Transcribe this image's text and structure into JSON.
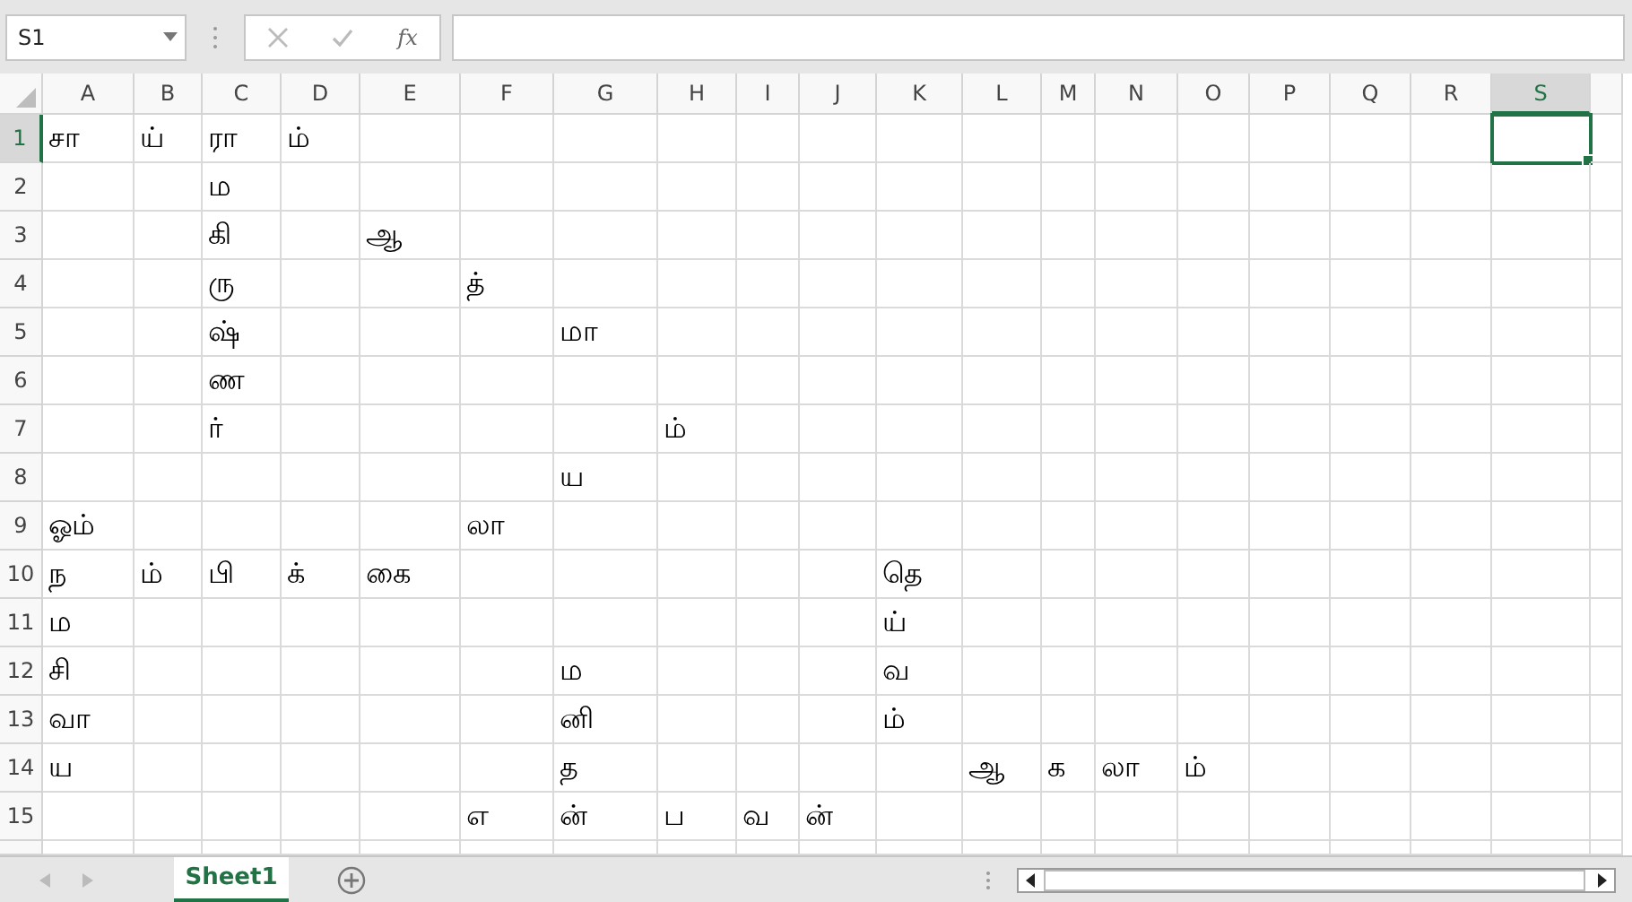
{
  "name_box": {
    "value": "S1"
  },
  "formula_bar": {
    "function_label": "fx",
    "value_disabled": true
  },
  "columns": [
    {
      "label": "A",
      "selected": false
    },
    {
      "label": "B",
      "selected": false
    },
    {
      "label": "C",
      "selected": false
    },
    {
      "label": "D",
      "selected": false
    },
    {
      "label": "E",
      "selected": false
    },
    {
      "label": "F",
      "selected": false
    },
    {
      "label": "G",
      "selected": false
    },
    {
      "label": "H",
      "selected": false
    },
    {
      "label": "I",
      "selected": false
    },
    {
      "label": "J",
      "selected": false
    },
    {
      "label": "K",
      "selected": false
    },
    {
      "label": "L",
      "selected": false
    },
    {
      "label": "M",
      "selected": false
    },
    {
      "label": "N",
      "selected": false
    },
    {
      "label": "O",
      "selected": false
    },
    {
      "label": "P",
      "selected": false
    },
    {
      "label": "Q",
      "selected": false
    },
    {
      "label": "R",
      "selected": false
    },
    {
      "label": "S",
      "selected": true
    }
  ],
  "rows": [
    {
      "label": "1",
      "selected": true,
      "cells": [
        "சா",
        "ய்",
        "ரா",
        "ம்"
      ]
    },
    {
      "label": "2",
      "selected": false,
      "cells": [
        null,
        null,
        "ம"
      ]
    },
    {
      "label": "3",
      "selected": false,
      "cells": [
        null,
        null,
        "கி",
        null,
        "ஆ"
      ]
    },
    {
      "label": "4",
      "selected": false,
      "cells": [
        null,
        null,
        "ரு",
        null,
        null,
        "த்"
      ]
    },
    {
      "label": "5",
      "selected": false,
      "cells": [
        null,
        null,
        "ஷ்",
        null,
        null,
        null,
        "மா"
      ]
    },
    {
      "label": "6",
      "selected": false,
      "cells": [
        null,
        null,
        "ண"
      ]
    },
    {
      "label": "7",
      "selected": false,
      "cells": [
        null,
        null,
        "ர்",
        null,
        null,
        null,
        null,
        "ம்"
      ]
    },
    {
      "label": "8",
      "selected": false,
      "cells": [
        null,
        null,
        null,
        null,
        null,
        null,
        "ய"
      ]
    },
    {
      "label": "9",
      "selected": false,
      "cells": [
        "ஓம்",
        null,
        null,
        null,
        null,
        "லா"
      ]
    },
    {
      "label": "10",
      "selected": false,
      "cells": [
        "ந",
        "ம்",
        "பி",
        "க்",
        "கை",
        null,
        null,
        null,
        null,
        null,
        "தெ"
      ]
    },
    {
      "label": "11",
      "selected": false,
      "cells": [
        "ம",
        null,
        null,
        null,
        null,
        null,
        null,
        null,
        null,
        null,
        "ய்"
      ]
    },
    {
      "label": "12",
      "selected": false,
      "cells": [
        "சி",
        null,
        null,
        null,
        null,
        null,
        "ம",
        null,
        null,
        null,
        "வ"
      ]
    },
    {
      "label": "13",
      "selected": false,
      "cells": [
        "வா",
        null,
        null,
        null,
        null,
        null,
        "னி",
        null,
        null,
        null,
        "ம்"
      ]
    },
    {
      "label": "14",
      "selected": false,
      "cells": [
        "ய",
        null,
        null,
        null,
        null,
        null,
        "த",
        null,
        null,
        null,
        null,
        "ஆ",
        "க",
        "லா",
        "ம்"
      ]
    },
    {
      "label": "15",
      "selected": false,
      "cells": [
        null,
        null,
        null,
        null,
        null,
        "எ",
        "ன்",
        "ப",
        "வ",
        "ன்"
      ]
    }
  ],
  "sheet_tabs": [
    {
      "label": "Sheet1",
      "selected": true
    }
  ]
}
